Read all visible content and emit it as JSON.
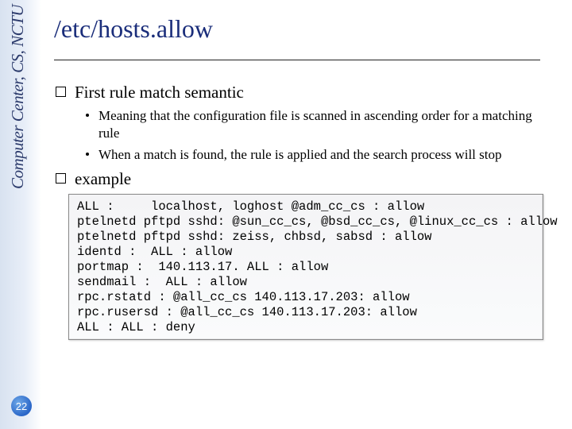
{
  "sidebar": {
    "org_text": "Computer Center, CS, NCTU"
  },
  "page_number": "22",
  "title": "/etc/hosts.allow",
  "items": [
    {
      "label": "First rule match semantic",
      "subs": [
        "Meaning that the configuration file is scanned in ascending order for a matching rule",
        "When a match is found, the rule is applied and the search process will stop"
      ]
    },
    {
      "label": "example",
      "subs": []
    }
  ],
  "codebox": "ALL :     localhost, loghost @adm_cc_cs : allow\nptelnetd pftpd sshd: @sun_cc_cs, @bsd_cc_cs, @linux_cc_cs : allow\nptelnetd pftpd sshd: zeiss, chbsd, sabsd : allow\nidentd :  ALL : allow\nportmap :  140.113.17. ALL : allow\nsendmail :  ALL : allow\nrpc.rstatd : @all_cc_cs 140.113.17.203: allow\nrpc.rusersd : @all_cc_cs 140.113.17.203: allow\nALL : ALL : deny"
}
